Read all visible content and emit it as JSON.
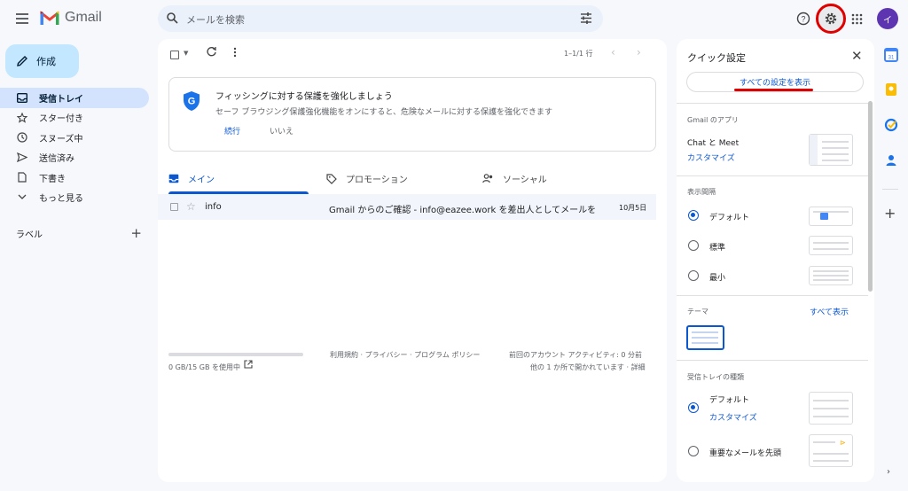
{
  "header": {
    "app_name": "Gmail",
    "search_placeholder": "メールを検索",
    "avatar_letter": "イ"
  },
  "sidebar": {
    "compose_label": "作成",
    "items": [
      {
        "label": "受信トレイ",
        "icon": "inbox-icon",
        "active": true
      },
      {
        "label": "スター付き",
        "icon": "star-icon"
      },
      {
        "label": "スヌーズ中",
        "icon": "clock-icon"
      },
      {
        "label": "送信済み",
        "icon": "send-icon"
      },
      {
        "label": "下書き",
        "icon": "draft-icon"
      },
      {
        "label": "もっと見る",
        "icon": "chevron-down-icon"
      }
    ],
    "labels_title": "ラベル",
    "labels_add": "+"
  },
  "toolbar": {
    "pager": "1–1/1 行",
    "prev": "‹",
    "next": "›"
  },
  "banner": {
    "title": "フィッシングに対する保護を強化しましょう",
    "description": "セーフ ブラウジング保護強化機能をオンにすると、危険なメールに対する保護を強化できます",
    "continue_label": "続行",
    "no_label": "いいえ"
  },
  "tabs": [
    {
      "label": "メイン",
      "icon": "inbox-icon",
      "active": true
    },
    {
      "label": "プロモーション",
      "icon": "tag-icon"
    },
    {
      "label": "ソーシャル",
      "icon": "people-icon"
    }
  ],
  "emails": [
    {
      "from": "info",
      "subject": "Gmail からのご確認 - info@eazee.work を差出人としてメールを…",
      "date": "10月5日"
    }
  ],
  "footer": {
    "storage": "0 GB/15 GB を使用中",
    "storage_fraction": 0.0,
    "terms": "利用規約 · プライバシー · プログラム ポリシー",
    "activity_line1": "前回のアカウント アクティビティ: 0 分前",
    "activity_line2": "他の 1 か所で開かれています · 詳細"
  },
  "quick_settings": {
    "title": "クイック設定",
    "close": "✕",
    "see_all": "すべての設定を表示",
    "apps_heading": "Gmail のアプリ",
    "chat_meet": "Chat と Meet",
    "customize": "カスタマイズ",
    "density_heading": "表示間隔",
    "density_options": [
      {
        "label": "デフォルト",
        "selected": true
      },
      {
        "label": "標準",
        "selected": false
      },
      {
        "label": "最小",
        "selected": false
      }
    ],
    "theme_heading": "テーマ",
    "theme_see_all": "すべて表示",
    "inbox_type_heading": "受信トレイの種類",
    "inbox_default": "デフォルト",
    "inbox_customize": "カスタマイズ",
    "inbox_important": "重要なメールを先頭"
  },
  "colors": {
    "accent": "#0b57d0",
    "highlight_ring": "#e00000",
    "compose_bg": "#c2e7ff",
    "active_nav_bg": "#d3e3fd"
  }
}
